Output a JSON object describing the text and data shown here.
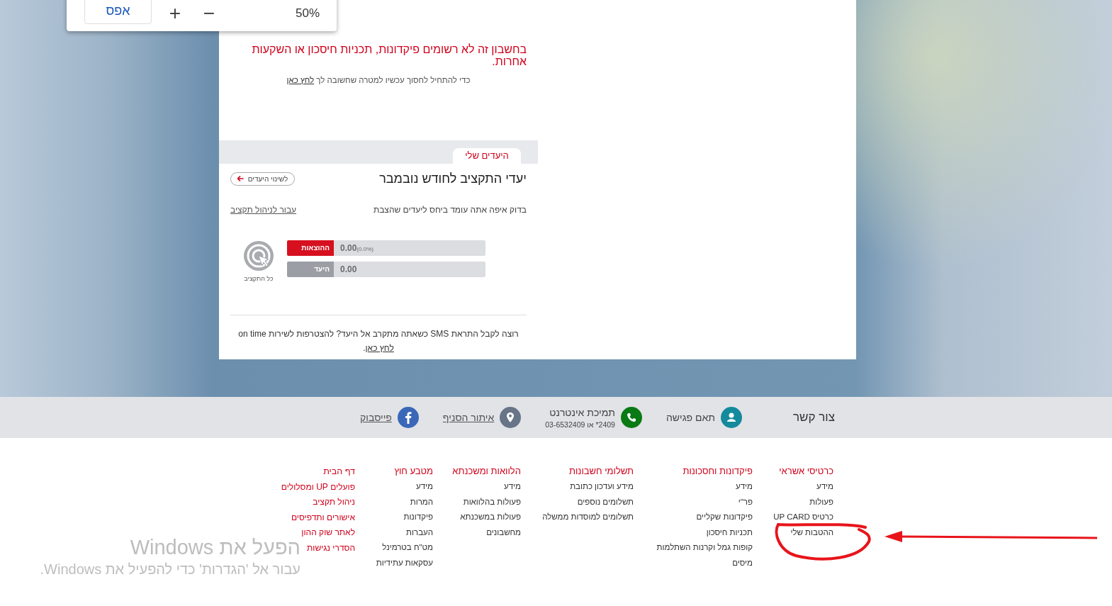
{
  "zoom_popup": {
    "reset_label": "אפס",
    "zoom_in": "+",
    "zoom_out": "−",
    "level_text": "50%"
  },
  "notice": {
    "message": "בחשבון זה לא רשומים פיקדונות, תכניות חיסכון או השקעות אחרות.",
    "hint": "כדי להתחיל לחסוך עכשיו למטרה שחשובה לך",
    "hint_link": "לחץ כאן"
  },
  "goals": {
    "tabs": [
      {
        "label": "היעדים שלי",
        "selected": true
      }
    ],
    "title": "יעדי התקציב לחודש נובמבר",
    "change_button": "לשינוי היעדים",
    "subtitle": "בדוק איפה אתה עומד ביחס ליעדים שהצבת",
    "manage_link": "עבור לניהול תקציב",
    "bars": [
      {
        "kind": "expense",
        "label": "ההוצאות",
        "value": "0.00",
        "percent": "(0.0%)",
        "level": 0
      },
      {
        "kind": "target",
        "label": "היעד",
        "value": "0.00",
        "level": 0
      }
    ],
    "budget_label": "כל התקציב",
    "sms": {
      "text": "רוצה לקבל התראת SMS כשאתה מתקרב אל היעד? להצטרפות לשירות on time",
      "link": "לחץ כאן",
      "end": "."
    }
  },
  "contact_bar": {
    "title": "צור קשר",
    "items": [
      {
        "kind": "person",
        "label": "תאם פגישה",
        "color": "#148a9c"
      },
      {
        "kind": "phone",
        "label": "תמיכת אינטרנט",
        "detail": "2409* או 03-6532409",
        "color": "#0a7a14"
      },
      {
        "kind": "pin",
        "label": "איתור הסניף",
        "link": true,
        "color": "#687488"
      },
      {
        "kind": "facebook",
        "label": "פייסבוק",
        "link": true,
        "color": "#3a67b8"
      }
    ]
  },
  "footer": {
    "columns": [
      {
        "heading": "כרטיסי אשראי",
        "items": [
          "מידע",
          "פעולות",
          "כרטיס UP CARD",
          "ההטבות שלי"
        ]
      },
      {
        "heading": "פיקדונות וחסכונות",
        "items": [
          "מידע",
          "פר\"י",
          "פיקדונות שקליים",
          "תכניות חיסכון",
          "קופות גמל וקרנות השתלמות",
          "מיסים"
        ]
      },
      {
        "heading": "תשלומי חשבונות",
        "items": [
          "מידע ועדכון כתובת",
          "תשלומים נוספים",
          "תשלומים למוסדות ממשלה"
        ]
      },
      {
        "heading": "הלוואות ומשכנתא",
        "items": [
          "מידע",
          "פעולות בהלוואות",
          "פעולות במשכנתא",
          "מחשבונים"
        ]
      },
      {
        "heading": "מטבע חוץ",
        "items": [
          "מידע",
          "המרות",
          "פיקדונות",
          "העברות",
          "מט\"ח בטרמינל",
          "עסקאות עתידיות"
        ]
      }
    ],
    "quick_links": [
      "דף הבית",
      "פועלים UP ומסלולים",
      "ניהול תקציב",
      "אישורים ותדפיסים",
      "לאתר שוק ההון",
      "הסדרי נגישות"
    ]
  },
  "windows_activation": {
    "title": "הפעל את Windows",
    "text": "עבור אל 'הגדרות' כדי להפעיל את Windows."
  }
}
